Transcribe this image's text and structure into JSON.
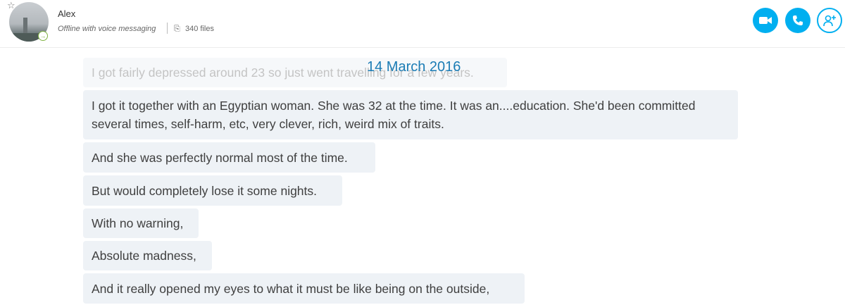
{
  "contact": {
    "name": "Alex",
    "status": "Offline with voice messaging",
    "files": "340 files"
  },
  "header_actions": {
    "video_icon": "video-camera-icon",
    "call_icon": "phone-icon",
    "add_icon": "add-person-icon"
  },
  "colors": {
    "accent": "#00aff0",
    "date": "#1b7cb5",
    "bubble": "#eef2f6"
  },
  "conversation": {
    "date": "14 March 2016",
    "messages": [
      "I got fairly depressed around 23 so just went travelling for a few years.",
      "I got it together with an Egyptian woman. She was 32 at the time. It was an....education. She'd been committed several times, self-harm, etc, very clever, rich, weird mix of traits.",
      "And she was perfectly normal most of the time.",
      "But would completely lose it some nights.",
      "With no warning,",
      "Absolute madness,",
      "And it really opened my eyes to what it must be like being on the outside,"
    ]
  }
}
